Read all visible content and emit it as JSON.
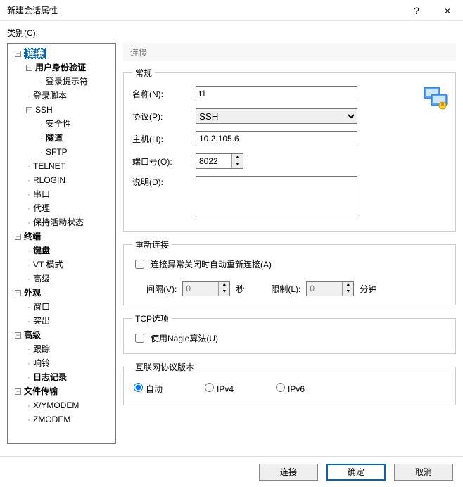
{
  "title": "新建会话属性",
  "help_char": "?",
  "close_char": "×",
  "category_label": "类别(C):",
  "tree": {
    "connection": "连接",
    "auth": "用户身份验证",
    "login_prompt": "登录提示符",
    "login_script": "登录脚本",
    "ssh": "SSH",
    "security": "安全性",
    "tunnel": "隧道",
    "sftp": "SFTP",
    "telnet": "TELNET",
    "rlogin": "RLOGIN",
    "serial": "串口",
    "proxy": "代理",
    "keepalive": "保持活动状态",
    "terminal": "终端",
    "keyboard": "键盘",
    "vt": "VT 模式",
    "advanced_t": "高级",
    "appearance": "外观",
    "window": "窗口",
    "highlight": "突出",
    "advanced": "高级",
    "trace": "跟踪",
    "bell": "响铃",
    "log": "日志记录",
    "file_transfer": "文件传输",
    "xymodem": "X/YMODEM",
    "zmodem": "ZMODEM"
  },
  "panel_header": "连接",
  "general": {
    "legend": "常规",
    "name_label": "名称(N):",
    "name_value": "t1",
    "proto_label": "协议(P):",
    "proto_value": "SSH",
    "host_label": "主机(H):",
    "host_value": "10.2.105.6",
    "port_label": "端口号(O):",
    "port_value": "8022",
    "desc_label": "说明(D):",
    "desc_value": ""
  },
  "reconnect": {
    "legend": "重新连接",
    "checkbox": "连接异常关闭时自动重新连接(A)",
    "interval_label": "间隔(V):",
    "interval_value": "0",
    "seconds": "秒",
    "limit_label": "限制(L):",
    "limit_value": "0",
    "minutes": "分钟"
  },
  "tcp": {
    "legend": "TCP选项",
    "nagle": "使用Nagle算法(U)"
  },
  "ipver": {
    "legend": "互联网协议版本",
    "auto": "自动",
    "ipv4": "IPv4",
    "ipv6": "IPv6"
  },
  "footer": {
    "connect": "连接",
    "ok": "确定",
    "cancel": "取消"
  }
}
